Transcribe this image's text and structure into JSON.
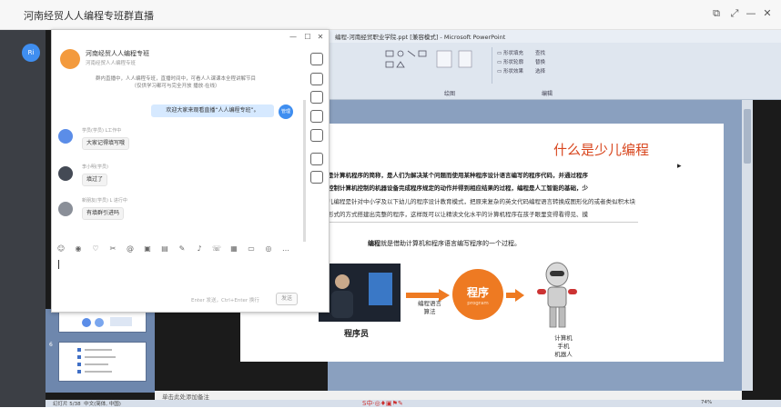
{
  "app": {
    "title": "河南经贸人人编程专班群直播"
  },
  "ppt": {
    "title": "编程-河南经贸职业学院.ppt [兼容模式] - Microsoft PowerPoint",
    "ribbon": {
      "group_drawing": "绘图",
      "group_editing": "编辑",
      "find": "查找",
      "replace": "替换",
      "select": "选择"
    },
    "notes_placeholder": "单击此处添加备注",
    "status_slide": "幻灯片 5/38",
    "status_lang": "中文(简体, 中国)",
    "zoom": "74%"
  },
  "slide": {
    "title": "什么是少儿编程",
    "line1": "是计算机程序的简称，是人们为解决某个问题而使用某种程序设计语言编写的程序代码，并通过程序",
    "line2": "控制计算机控制的机器设备完成程序规定的动作并得到相应结果的过程，编程是人工智能的基础，少",
    "line3": "儿编程是针对中小学及以下幼儿的程序设计教育模式，把原来复杂的英文代码编程语言转换成图形化的或者类似积木块",
    "line4": "形式的方式搭建出完整的程序，这样既可以让精读文化水平的计算机程序在孩子眼里变得看得见、摸",
    "caption_bold": "编程",
    "caption_rest": "就是借助计算机和程序语言编写程序的一个过程。",
    "person_label": "程序员",
    "arrow_label_1": "编程语言",
    "arrow_label_2": "算法",
    "program_label": "程序",
    "program_sub": "program",
    "robot_label_1": "计算机",
    "robot_label_2": "手机",
    "robot_label_3": "机器人"
  },
  "chat": {
    "group_name": "河南经贸人人编程专班",
    "group_sub": "河南经贸人人编程专班",
    "notice": "群内直播中，人人编程专班，直播时间中，可看人人课课本全程讲解节目",
    "notice2": "（仅供学习都可与完全开放    播放·在线）",
    "welcome": "欢迎大家来观看直播“人人编程专班”。",
    "self_avatar": "管理",
    "messages": [
      {
        "name": "学员(学员)",
        "meta": "L工作中",
        "text": "大家记得填写哦",
        "avatar_color": "#5b8de8"
      },
      {
        "name": "李小明(学员)",
        "meta": "",
        "text": "填过了",
        "avatar_color": "#444a55"
      },
      {
        "name": "新朋友(学员)",
        "meta": "L 进行中",
        "text": "有填群引进吗",
        "avatar_color": "#8a8f98"
      }
    ],
    "send_hint": "Enter 发送，Ctrl+Enter 换行",
    "send_label": "发送"
  },
  "left_strip": {
    "avatar_text": "Ri"
  },
  "colors": {
    "accent_orange": "#ee7a22",
    "title_red": "#d8461e",
    "chat_blue": "#3f8ef0"
  }
}
